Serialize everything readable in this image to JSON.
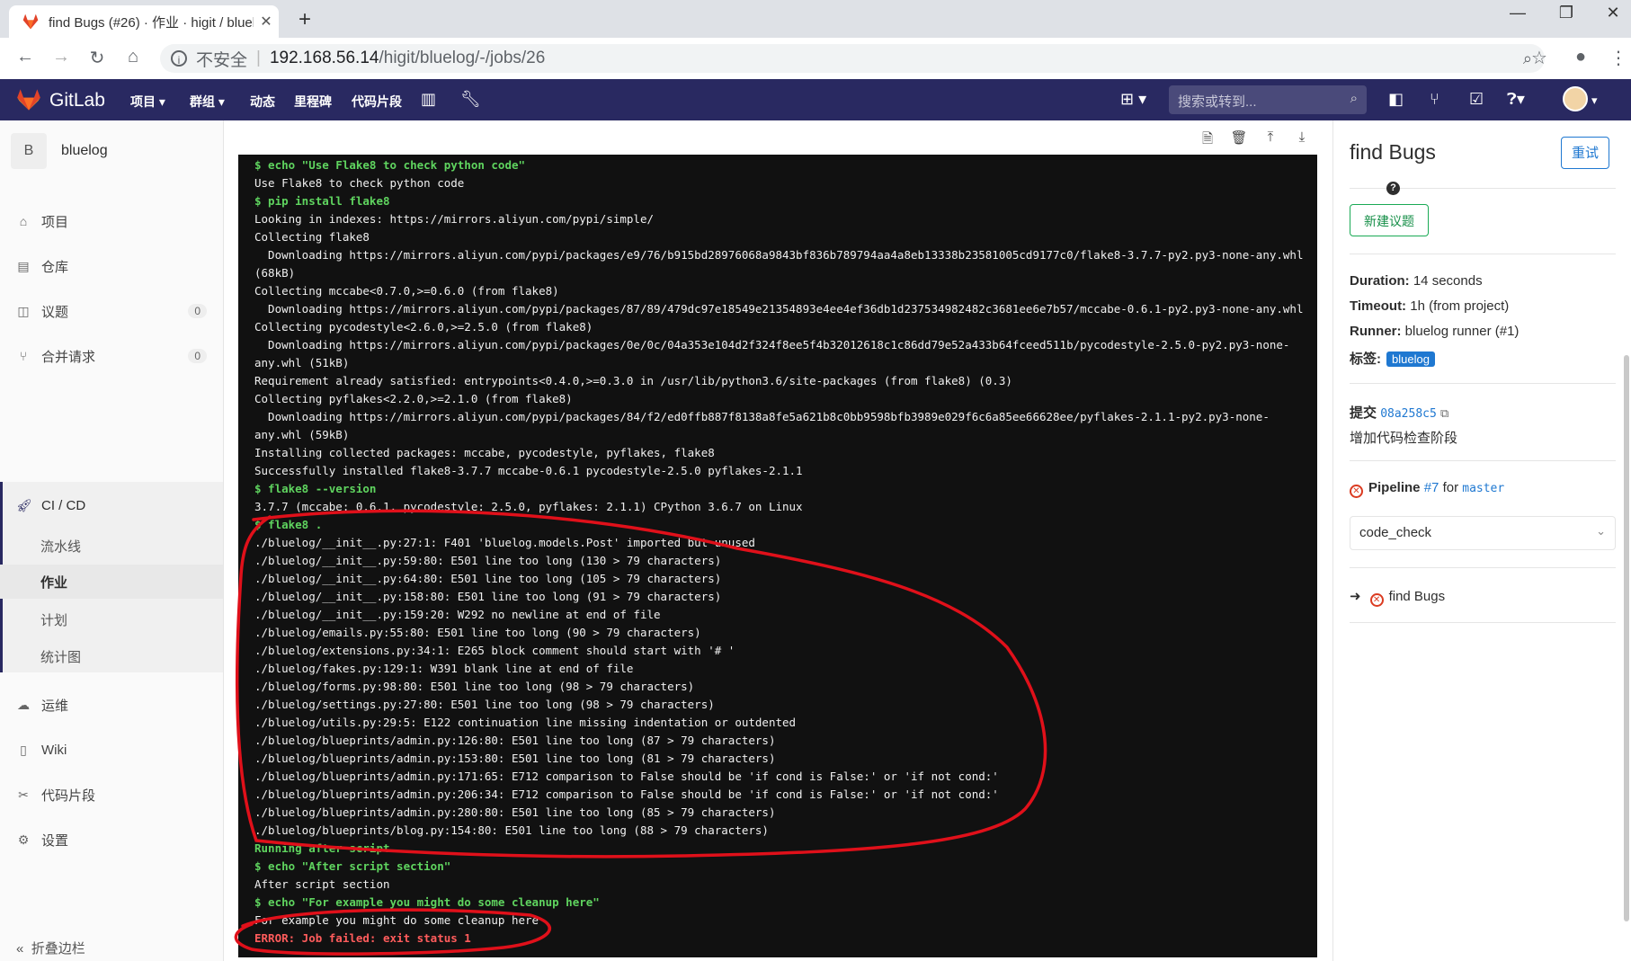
{
  "browser": {
    "tab_title": "find Bugs (#26) · 作业 · higit / bluelog",
    "insecure_label": "不安全",
    "url_host": "192.168.56.14",
    "url_path": "/higit/bluelog/-/jobs/26"
  },
  "header": {
    "brand": "GitLab",
    "nav": [
      "项目",
      "群组",
      "动态",
      "里程碑",
      "代码片段"
    ],
    "search_placeholder": "搜索或转到..."
  },
  "sidebar": {
    "project_initial": "B",
    "project_name": "bluelog",
    "items": [
      {
        "label": "项目"
      },
      {
        "label": "仓库"
      },
      {
        "label": "议题",
        "count": "0"
      },
      {
        "label": "合并请求",
        "count": "0"
      },
      {
        "label": "CI / CD"
      },
      {
        "label": "运维"
      },
      {
        "label": "Wiki"
      },
      {
        "label": "代码片段"
      },
      {
        "label": "设置"
      }
    ],
    "cicd_sub": [
      "流水线",
      "作业",
      "计划",
      "统计图"
    ],
    "collapse_label": "折叠边栏"
  },
  "log": {
    "lines": [
      {
        "t": "$ echo \"Use Flake8 to check python code\"",
        "c": "g"
      },
      {
        "t": "Use Flake8 to check python code",
        "c": ""
      },
      {
        "t": "$ pip install flake8",
        "c": "g"
      },
      {
        "t": "Looking in indexes: https://mirrors.aliyun.com/pypi/simple/",
        "c": ""
      },
      {
        "t": "Collecting flake8",
        "c": ""
      },
      {
        "t": "  Downloading https://mirrors.aliyun.com/pypi/packages/e9/76/b915bd28976068a9843bf836b789794aa4a8eb13338b23581005cd9177c0/flake8-3.7.7-py2.py3-none-any.whl",
        "c": ""
      },
      {
        "t": "(68kB)",
        "c": ""
      },
      {
        "t": "Collecting mccabe<0.7.0,>=0.6.0 (from flake8)",
        "c": ""
      },
      {
        "t": "  Downloading https://mirrors.aliyun.com/pypi/packages/87/89/479dc97e18549e21354893e4ee4ef36db1d237534982482c3681ee6e7b57/mccabe-0.6.1-py2.py3-none-any.whl",
        "c": ""
      },
      {
        "t": "Collecting pycodestyle<2.6.0,>=2.5.0 (from flake8)",
        "c": ""
      },
      {
        "t": "  Downloading https://mirrors.aliyun.com/pypi/packages/0e/0c/04a353e104d2f324f8ee5f4b32012618c1c86dd79e52a433b64fceed511b/pycodestyle-2.5.0-py2.py3-none-",
        "c": ""
      },
      {
        "t": "any.whl (51kB)",
        "c": ""
      },
      {
        "t": "Requirement already satisfied: entrypoints<0.4.0,>=0.3.0 in /usr/lib/python3.6/site-packages (from flake8) (0.3)",
        "c": ""
      },
      {
        "t": "Collecting pyflakes<2.2.0,>=2.1.0 (from flake8)",
        "c": ""
      },
      {
        "t": "  Downloading https://mirrors.aliyun.com/pypi/packages/84/f2/ed0ffb887f8138a8fe5a621b8c0bb9598bfb3989e029f6c6a85ee66628ee/pyflakes-2.1.1-py2.py3-none-",
        "c": ""
      },
      {
        "t": "any.whl (59kB)",
        "c": ""
      },
      {
        "t": "Installing collected packages: mccabe, pycodestyle, pyflakes, flake8",
        "c": ""
      },
      {
        "t": "Successfully installed flake8-3.7.7 mccabe-0.6.1 pycodestyle-2.5.0 pyflakes-2.1.1",
        "c": ""
      },
      {
        "t": "$ flake8 --version",
        "c": "g"
      },
      {
        "t": "3.7.7 (mccabe: 0.6.1, pycodestyle: 2.5.0, pyflakes: 2.1.1) CPython 3.6.7 on Linux",
        "c": ""
      },
      {
        "t": "$ flake8 .",
        "c": "g"
      },
      {
        "t": "./bluelog/__init__.py:27:1: F401 'bluelog.models.Post' imported but unused",
        "c": ""
      },
      {
        "t": "./bluelog/__init__.py:59:80: E501 line too long (130 > 79 characters)",
        "c": ""
      },
      {
        "t": "./bluelog/__init__.py:64:80: E501 line too long (105 > 79 characters)",
        "c": ""
      },
      {
        "t": "./bluelog/__init__.py:158:80: E501 line too long (91 > 79 characters)",
        "c": ""
      },
      {
        "t": "./bluelog/__init__.py:159:20: W292 no newline at end of file",
        "c": ""
      },
      {
        "t": "./bluelog/emails.py:55:80: E501 line too long (90 > 79 characters)",
        "c": ""
      },
      {
        "t": "./bluelog/extensions.py:34:1: E265 block comment should start with '# '",
        "c": ""
      },
      {
        "t": "./bluelog/fakes.py:129:1: W391 blank line at end of file",
        "c": ""
      },
      {
        "t": "./bluelog/forms.py:98:80: E501 line too long (98 > 79 characters)",
        "c": ""
      },
      {
        "t": "./bluelog/settings.py:27:80: E501 line too long (98 > 79 characters)",
        "c": ""
      },
      {
        "t": "./bluelog/utils.py:29:5: E122 continuation line missing indentation or outdented",
        "c": ""
      },
      {
        "t": "./bluelog/blueprints/admin.py:126:80: E501 line too long (87 > 79 characters)",
        "c": ""
      },
      {
        "t": "./bluelog/blueprints/admin.py:153:80: E501 line too long (81 > 79 characters)",
        "c": ""
      },
      {
        "t": "./bluelog/blueprints/admin.py:171:65: E712 comparison to False should be 'if cond is False:' or 'if not cond:'",
        "c": ""
      },
      {
        "t": "./bluelog/blueprints/admin.py:206:34: E712 comparison to False should be 'if cond is False:' or 'if not cond:'",
        "c": ""
      },
      {
        "t": "./bluelog/blueprints/admin.py:280:80: E501 line too long (85 > 79 characters)",
        "c": ""
      },
      {
        "t": "./bluelog/blueprints/blog.py:154:80: E501 line too long (88 > 79 characters)",
        "c": ""
      },
      {
        "t": "Running after script...",
        "c": "g"
      },
      {
        "t": "$ echo \"After script section\"",
        "c": "g"
      },
      {
        "t": "After script section",
        "c": ""
      },
      {
        "t": "$ echo \"For example you might do some cleanup here\"",
        "c": "g"
      },
      {
        "t": "For example you might do some cleanup here",
        "c": ""
      },
      {
        "t": "ERROR: Job failed: exit status 1",
        "c": "r"
      }
    ]
  },
  "job": {
    "title": "find Bugs",
    "retry_label": "重试",
    "new_issue_label": "新建议题",
    "duration_label": "Duration:",
    "duration_value": "14 seconds",
    "timeout_label": "Timeout:",
    "timeout_value": "1h (from project)",
    "runner_label": "Runner:",
    "runner_value": "bluelog runner (#1)",
    "tags_label": "标签:",
    "tag": "bluelog",
    "commit_label": "提交",
    "commit_sha": "08a258c5",
    "commit_message": "增加代码检查阶段",
    "pipeline_label": "Pipeline",
    "pipeline_id": "#7",
    "pipeline_for": "for",
    "pipeline_ref": "master",
    "stage": "code_check",
    "job_list": [
      {
        "name": "find Bugs"
      }
    ]
  },
  "colors": {
    "header_bg": "#292961",
    "annotation": "#e0101a",
    "log_green": "#5fd45f",
    "log_red": "#ff5c5c",
    "accent_blue": "#1f78d1"
  }
}
